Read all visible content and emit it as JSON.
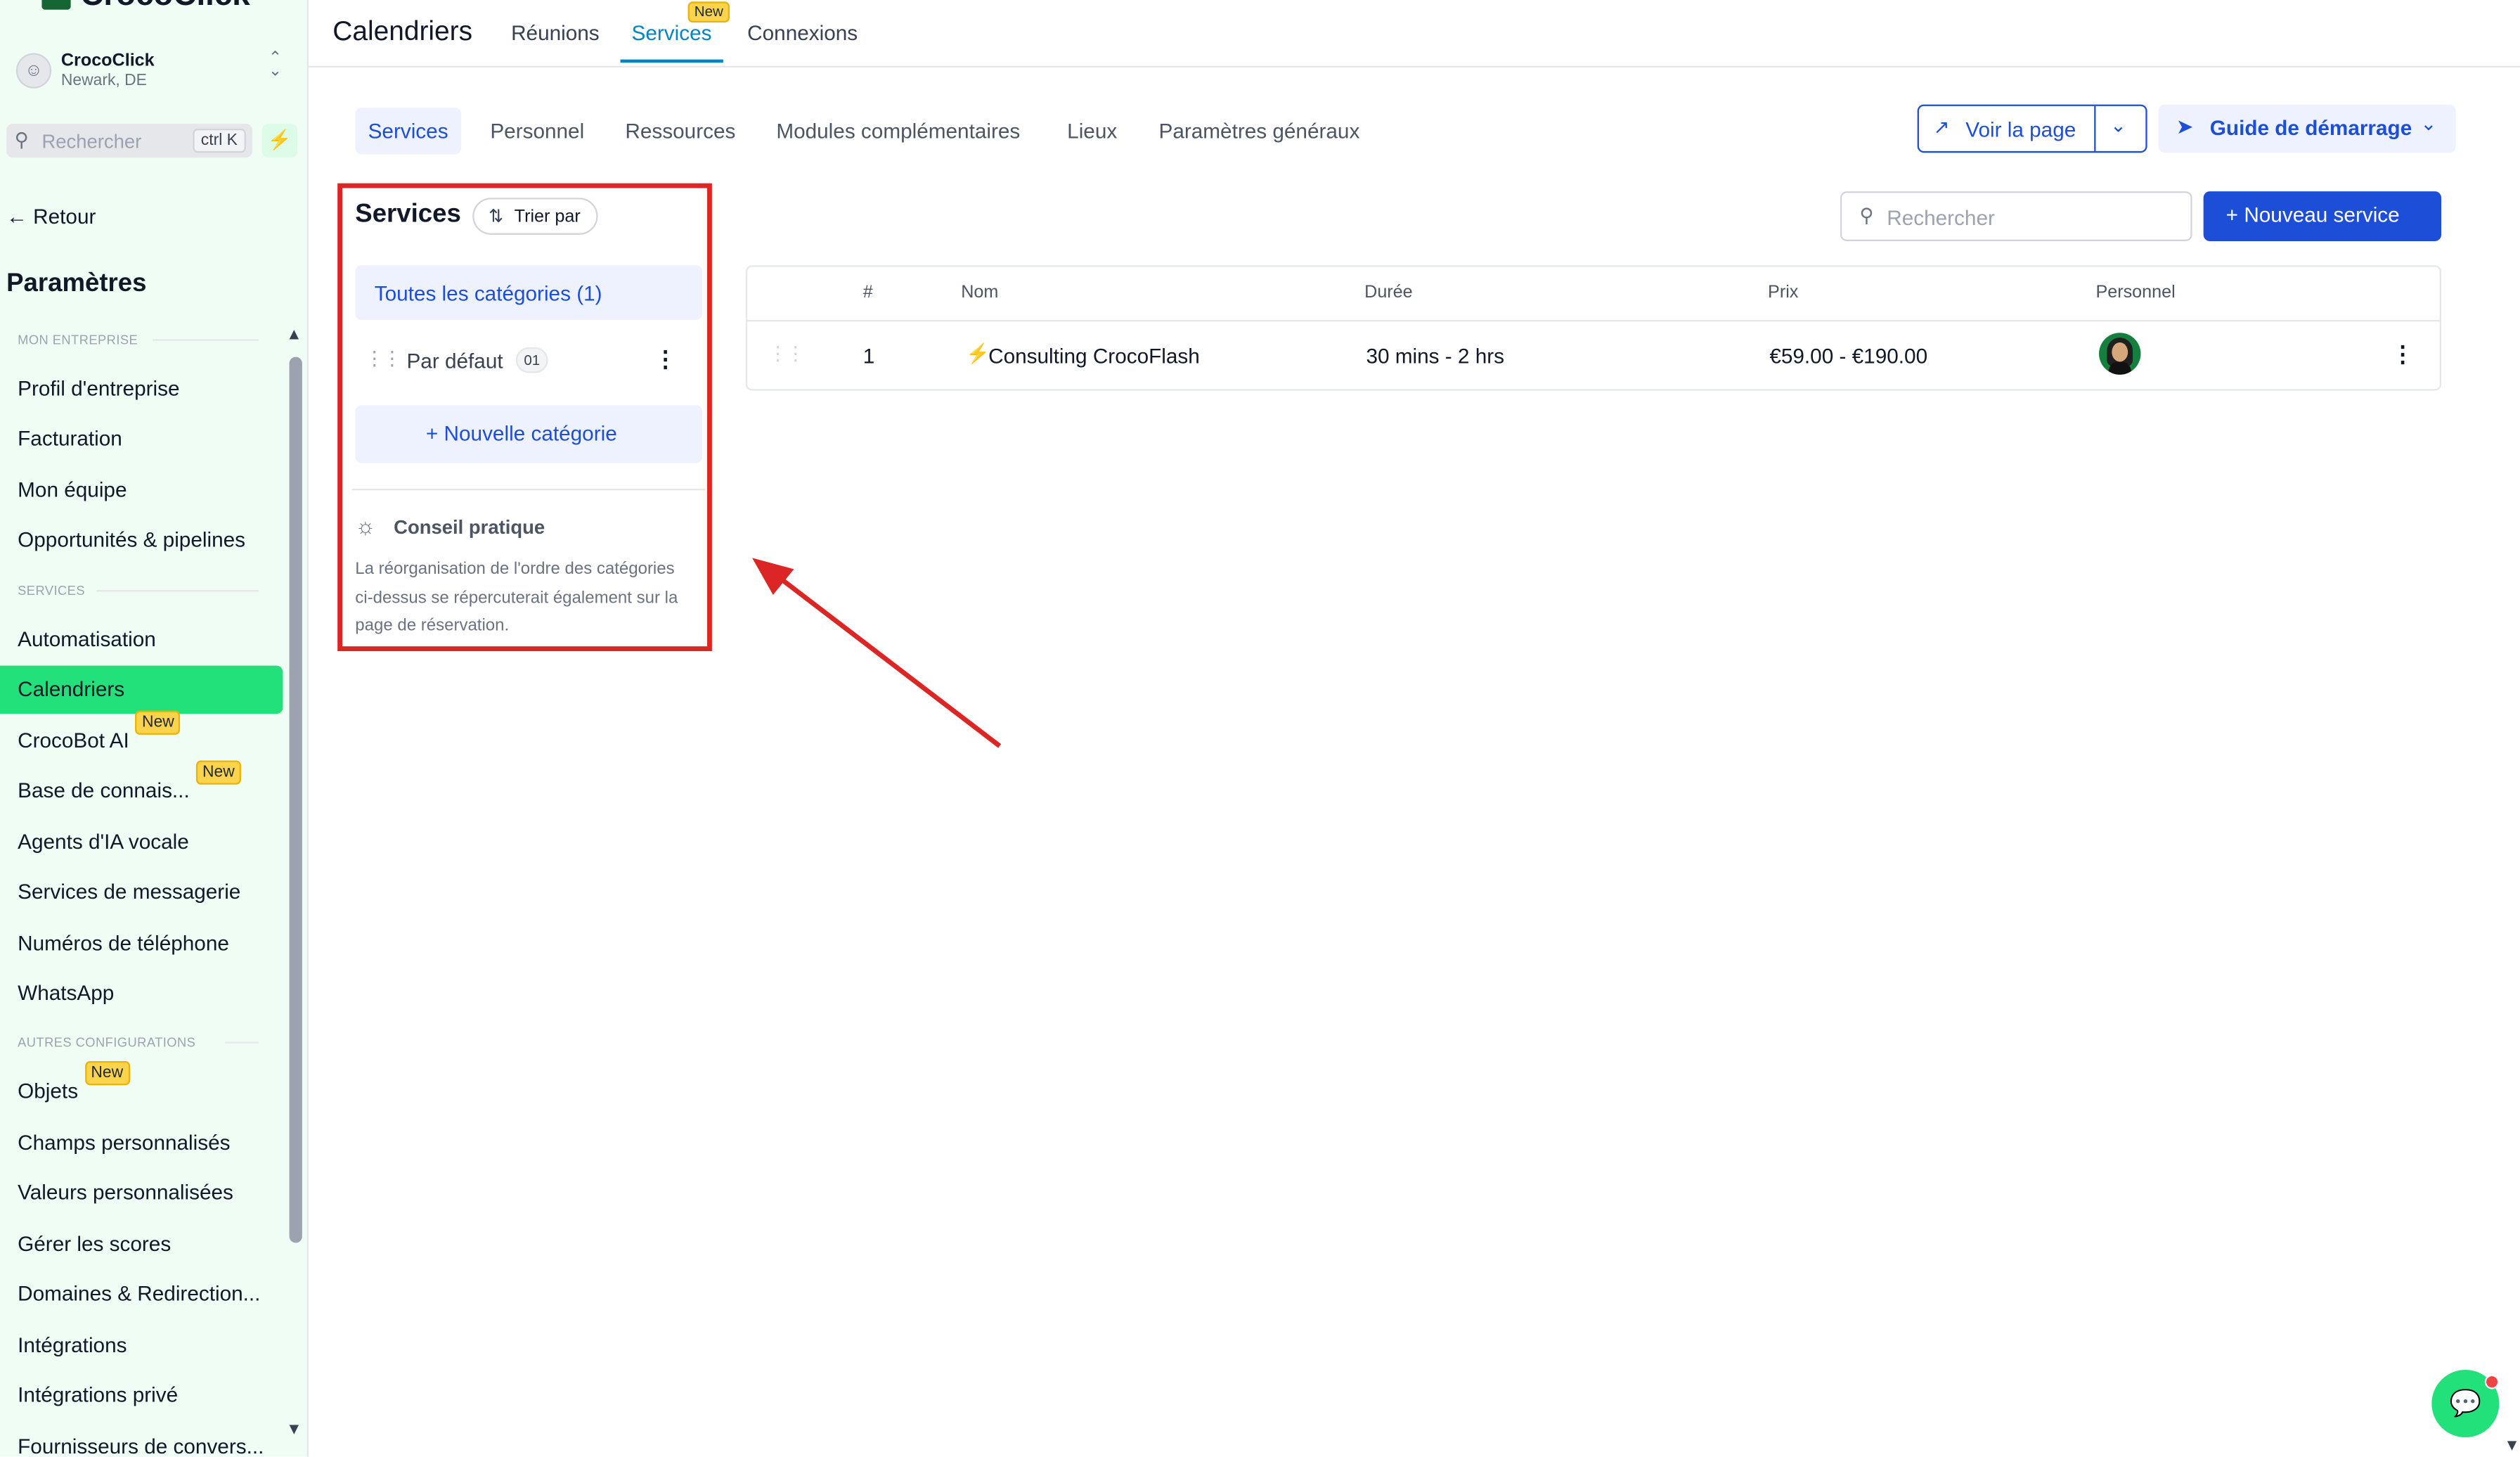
{
  "app": {
    "logo_text": "CrocoClick"
  },
  "account": {
    "name": "CrocoClick",
    "location": "Newark, DE"
  },
  "sidebar": {
    "search_placeholder": "Rechercher",
    "shortcut": "ctrl K",
    "back_label": "Retour",
    "heading": "Paramètres",
    "sections": {
      "company": "MON ENTREPRISE",
      "services": "SERVICES",
      "other": "AUTRES CONFIGURATIONS"
    },
    "items": [
      {
        "label": "Profil d'entreprise"
      },
      {
        "label": "Facturation"
      },
      {
        "label": "Mon équipe"
      },
      {
        "label": "Opportunités & pipelines"
      },
      {
        "label": "Automatisation"
      },
      {
        "label": "Calendriers",
        "active": true
      },
      {
        "label": "CrocoBot AI",
        "badge": "New"
      },
      {
        "label": "Base de connais...",
        "badge": "New"
      },
      {
        "label": "Agents d'IA vocale"
      },
      {
        "label": "Services de messagerie"
      },
      {
        "label": "Numéros de téléphone"
      },
      {
        "label": "WhatsApp"
      },
      {
        "label": "Objets",
        "badge": "New"
      },
      {
        "label": "Champs personnalisés"
      },
      {
        "label": "Valeurs personnalisées"
      },
      {
        "label": "Gérer les scores"
      },
      {
        "label": "Domaines & Redirection..."
      },
      {
        "label": "Intégrations"
      },
      {
        "label": "Intégrations privé"
      },
      {
        "label": "Fournisseurs de convers..."
      }
    ]
  },
  "topbar": {
    "title": "Calendriers",
    "tabs": [
      {
        "label": "Réunions"
      },
      {
        "label": "Services",
        "active": true,
        "badge": "New"
      },
      {
        "label": "Connexions"
      }
    ]
  },
  "subtabs": [
    {
      "label": "Services",
      "active": true
    },
    {
      "label": "Personnel"
    },
    {
      "label": "Ressources"
    },
    {
      "label": "Modules complémentaires"
    },
    {
      "label": "Lieux"
    },
    {
      "label": "Paramètres généraux"
    }
  ],
  "actions": {
    "view_page": "Voir la page",
    "guide": "Guide de démarrage"
  },
  "categories": {
    "title": "Services",
    "sort_label": "Trier par",
    "all_label": "Toutes les catégories (1)",
    "items": [
      {
        "label": "Par défaut",
        "count": "01"
      }
    ],
    "new_label": "Nouvelle catégorie",
    "tip_title": "Conseil pratique",
    "tip_body": "La réorganisation de l'ordre des catégories ci-dessus se répercuterait également sur la page de réservation."
  },
  "services": {
    "search_placeholder": "Rechercher",
    "new_label": "Nouveau service",
    "columns": [
      "#",
      "Nom",
      "Durée",
      "Prix",
      "Personnel"
    ],
    "rows": [
      {
        "index": "1",
        "name": "Consulting CrocoFlash",
        "duration": "30 mins - 2 hrs",
        "price": "€59.00 - €190.00"
      }
    ]
  },
  "icons": [
    "logo-icon",
    "user-icon",
    "chevron-updown-icon",
    "search-icon",
    "bolt-icon",
    "arrow-left-icon",
    "external-link-icon",
    "chevron-down-icon",
    "rocket-icon",
    "sort-icon",
    "drag-handle-icon",
    "more-vertical-icon",
    "plus-icon",
    "lightbulb-icon",
    "chat-icon"
  ],
  "colors": {
    "accent_green": "#22e07a",
    "primary_blue": "#1d4ed8",
    "highlight_red": "#dc2626",
    "badge_yellow": "#fcd34d"
  }
}
